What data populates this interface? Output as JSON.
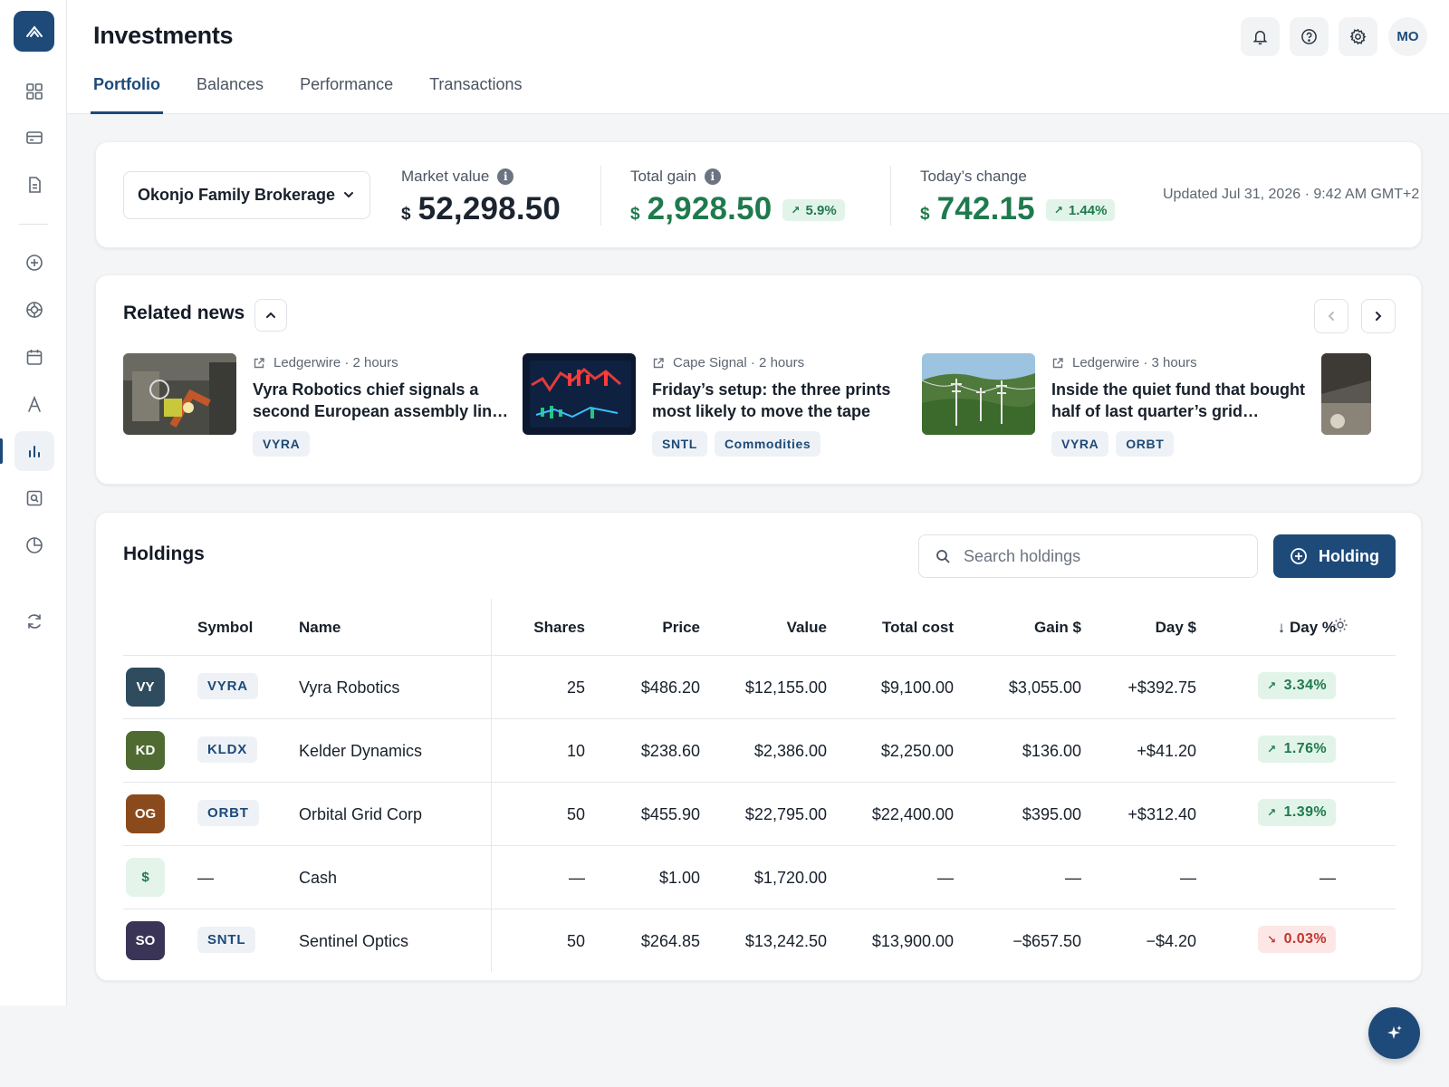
{
  "app": {
    "title": "Investments",
    "tabs": [
      {
        "label": "Portfolio"
      },
      {
        "label": "Balances"
      },
      {
        "label": "Performance"
      },
      {
        "label": "Transactions"
      }
    ],
    "avatar_initials": "MO",
    "accent_color": "#1d4a79"
  },
  "sidebar": {
    "icons": [
      "grid-icon",
      "card-icon",
      "document-icon",
      "plus-circle-icon",
      "target-icon",
      "calendar-icon",
      "letter-a-icon",
      "bar-chart-icon",
      "search-box-icon",
      "pie-chart-icon",
      "refresh-icon"
    ],
    "active": "bar-chart-icon"
  },
  "summary": {
    "account": "Okonjo Family Brokerage",
    "market_value": {
      "label": "Market value",
      "currency": "$",
      "value": "52,298.50"
    },
    "total_gain": {
      "label": "Total gain",
      "currency": "$",
      "value": "2,928.50",
      "badge": "5.9%"
    },
    "todays_change": {
      "label": "Today’s change",
      "currency": "$",
      "value": "742.15",
      "badge": "1.44%"
    },
    "updated": "Updated Jul 31, 2026 · 9:42 AM GMT+2"
  },
  "news": {
    "title": "Related news",
    "items": [
      {
        "source": "Ledgerwire · 2 hours",
        "headline": "Vyra Robotics chief signals a second European assembly lin…",
        "tags": [
          "VYRA"
        ]
      },
      {
        "source": "Cape Signal · 2 hours",
        "headline": "Friday’s setup: the three prints most likely to move the tape ne…",
        "tags": [
          "SNTL",
          "Commodities"
        ]
      },
      {
        "source": "Ledgerwire · 3 hours",
        "headline": "Inside the quiet fund that bought half of last quarter’s grid…",
        "tags": [
          "VYRA",
          "ORBT"
        ]
      }
    ]
  },
  "holdings": {
    "title": "Holdings",
    "search_placeholder": "Search holdings",
    "add_label": "Holding",
    "columns": [
      "Symbol",
      "Name",
      "Shares",
      "Price",
      "Value",
      "Total cost",
      "Gain $",
      "Day $",
      "↓ Day %"
    ],
    "rows": [
      {
        "initials": "VY",
        "color": "#2f4b5e",
        "symbol": "VYRA",
        "name": "Vyra Robotics",
        "shares": "25",
        "price": "$486.20",
        "value": "$12,155.00",
        "cost": "$9,100.00",
        "gain": "$3,055.00",
        "day": "+$392.75",
        "pct": "3.34%",
        "dir": "up"
      },
      {
        "initials": "KD",
        "color": "#4f6b32",
        "symbol": "KLDX",
        "name": "Kelder Dynamics",
        "shares": "10",
        "price": "$238.60",
        "value": "$2,386.00",
        "cost": "$2,250.00",
        "gain": "$136.00",
        "day": "+$41.20",
        "pct": "1.76%",
        "dir": "up"
      },
      {
        "initials": "OG",
        "color": "#8b4a1c",
        "symbol": "ORBT",
        "name": "Orbital Grid Corp",
        "shares": "50",
        "price": "$455.90",
        "value": "$22,795.00",
        "cost": "$22,400.00",
        "gain": "$395.00",
        "day": "+$312.40",
        "pct": "1.39%",
        "dir": "up"
      },
      {
        "initials": "$",
        "color": "#e4f4ea",
        "symbol": "—",
        "name": "Cash",
        "shares": "—",
        "price": "$1.00",
        "value": "$1,720.00",
        "cost": "—",
        "gain": "—",
        "day": "—",
        "pct": "—",
        "dir": "none"
      },
      {
        "initials": "SO",
        "color": "#3a3556",
        "symbol": "SNTL",
        "name": "Sentinel Optics",
        "shares": "50",
        "price": "$264.85",
        "value": "$13,242.50",
        "cost": "$13,900.00",
        "gain": "−$657.50",
        "day": "−$4.20",
        "pct": "0.03%",
        "dir": "down"
      }
    ]
  }
}
